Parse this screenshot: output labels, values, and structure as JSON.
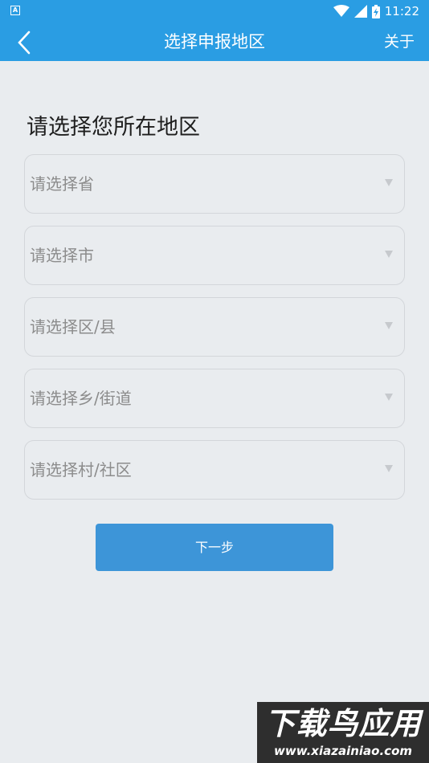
{
  "status_bar": {
    "time": "11:22",
    "icons": [
      "app-notification-icon",
      "wifi-icon",
      "signal-icon",
      "battery-charging-icon"
    ]
  },
  "app_bar": {
    "back_icon": "chevron-left-icon",
    "title": "选择申报地区",
    "about_label": "关于"
  },
  "form": {
    "heading": "请选择您所在地区",
    "selects": [
      {
        "placeholder": "请选择省"
      },
      {
        "placeholder": "请选择市"
      },
      {
        "placeholder": "请选择区/县"
      },
      {
        "placeholder": "请选择乡/街道"
      },
      {
        "placeholder": "请选择村/社区"
      }
    ],
    "next_label": "下一步"
  },
  "watermark": {
    "logo_text": "下载鸟应用",
    "url": "www.xiazainiao.com"
  },
  "colors": {
    "primary": "#2a9de3",
    "button": "#3d95d8",
    "background": "#e9ecef",
    "placeholder": "#8c8c8c"
  }
}
